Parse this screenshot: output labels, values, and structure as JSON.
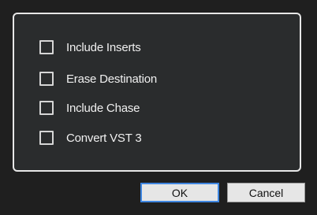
{
  "options": [
    {
      "label": "Include Inserts",
      "checked": false
    },
    {
      "label": "Erase Destination",
      "checked": false
    },
    {
      "label": "Include Chase",
      "checked": false
    },
    {
      "label": "Convert VST 3",
      "checked": false
    }
  ],
  "buttons": {
    "ok_label": "OK",
    "cancel_label": "Cancel"
  },
  "colors": {
    "background": "#1f1f1f",
    "panel": "#2a2c2d",
    "panel_border": "#e7e7e7",
    "focus_accent": "#3f86e0"
  }
}
